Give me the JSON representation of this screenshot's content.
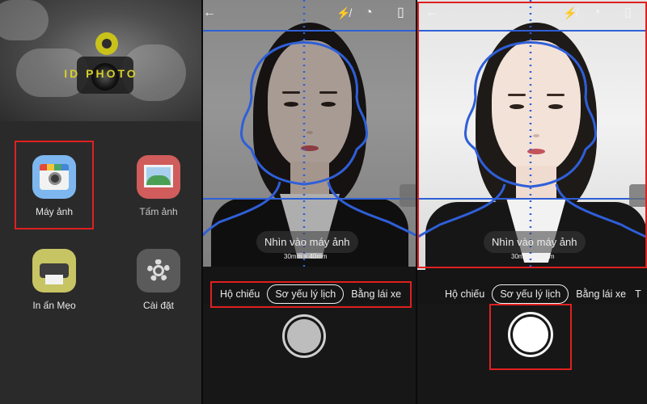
{
  "home": {
    "brand": "ID PHOTO",
    "tiles": [
      {
        "label": "Máy ảnh",
        "icon": "camera-app-icon"
      },
      {
        "label": "Tấm ảnh",
        "icon": "photo-gallery-icon"
      },
      {
        "label": "In ấn Mẹo",
        "icon": "printer-icon"
      },
      {
        "label": "Cài đặt",
        "icon": "settings-gear-icon"
      }
    ]
  },
  "camera_left": {
    "hint": "Nhìn vào máy ảnh",
    "size_label": "30mm × 40mm",
    "modes": [
      "Hộ chiếu",
      "Sơ yếu lý lịch",
      "Bằng lái xe"
    ],
    "active_mode": "Sơ yếu lý lịch"
  },
  "camera_right": {
    "hint": "Nhìn vào máy ảnh",
    "size_label": "30mm × 40mm",
    "modes": [
      "Hộ chiếu",
      "Sơ yếu lý lịch",
      "Bằng lái xe",
      "T"
    ],
    "active_mode": "Sơ yếu lý lịch"
  },
  "colors": {
    "guide_blue": "#2f5fd8",
    "highlight_red": "#e02020",
    "brand_yellow": "#d8cf2a"
  },
  "icons": {
    "back": "arrow-left-icon",
    "flash_off": "flash-off-icon",
    "timer": "timer-icon",
    "switch_camera": "switch-camera-icon"
  }
}
